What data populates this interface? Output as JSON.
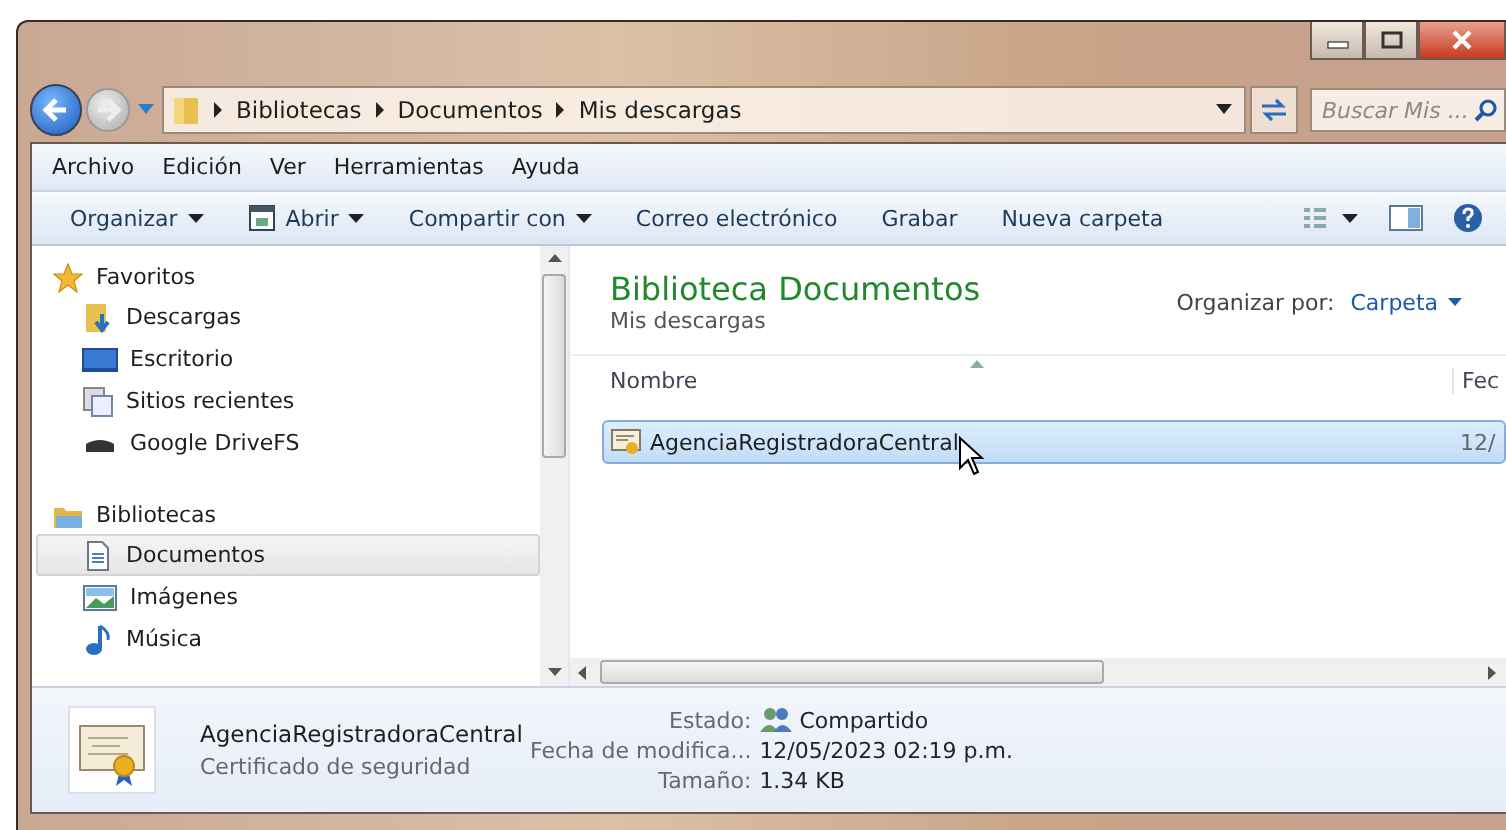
{
  "address_bar": {
    "breadcrumbs": [
      "Bibliotecas",
      "Documentos",
      "Mis descargas"
    ]
  },
  "search": {
    "placeholder": "Buscar Mis ..."
  },
  "menu": [
    "Archivo",
    "Edición",
    "Ver",
    "Herramientas",
    "Ayuda"
  ],
  "toolbar": [
    {
      "label": "Organizar",
      "kind": "dropdown"
    },
    {
      "label": "Abrir",
      "kind": "icon-dropdown"
    },
    {
      "label": "Compartir con",
      "kind": "dropdown"
    },
    {
      "label": "Correo electrónico",
      "kind": "plain"
    },
    {
      "label": "Grabar",
      "kind": "plain"
    },
    {
      "label": "Nueva carpeta",
      "kind": "plain"
    }
  ],
  "sidebar": {
    "groups": [
      {
        "label": "Favoritos",
        "kind": "star",
        "children": [
          {
            "label": "Descargas",
            "kind": "downloads",
            "selected": false
          },
          {
            "label": "Escritorio",
            "kind": "desktop",
            "selected": false
          },
          {
            "label": "Sitios recientes",
            "kind": "recent",
            "selected": false
          },
          {
            "label": "Google DriveFS",
            "kind": "drive",
            "selected": false
          }
        ]
      },
      {
        "label": "Bibliotecas",
        "kind": "library",
        "children": [
          {
            "label": "Documentos",
            "kind": "document",
            "selected": true
          },
          {
            "label": "Imágenes",
            "kind": "pictures",
            "selected": false
          },
          {
            "label": "Música",
            "kind": "music",
            "selected": false
          }
        ]
      }
    ]
  },
  "library": {
    "title": "Biblioteca Documentos",
    "subtitle": "Mis descargas",
    "arrange_label": "Organizar por:",
    "arrange_value": "Carpeta"
  },
  "table": {
    "columns": [
      "Nombre",
      "Fec"
    ],
    "rows": [
      {
        "cells": [
          "AgenciaRegistradoraCentral",
          "12/"
        ],
        "selected": true
      }
    ]
  },
  "details": {
    "name": "AgenciaRegistradoraCentral",
    "type": "Certificado de seguridad",
    "fields": [
      {
        "label": "Estado:",
        "value": "Compartido",
        "kind": "shared"
      },
      {
        "label": "Fecha de modifica...",
        "value": "12/05/2023 02:19 p.m.",
        "kind": "text"
      },
      {
        "label": "Tamaño:",
        "value": "1.34 KB",
        "kind": "text"
      }
    ]
  }
}
